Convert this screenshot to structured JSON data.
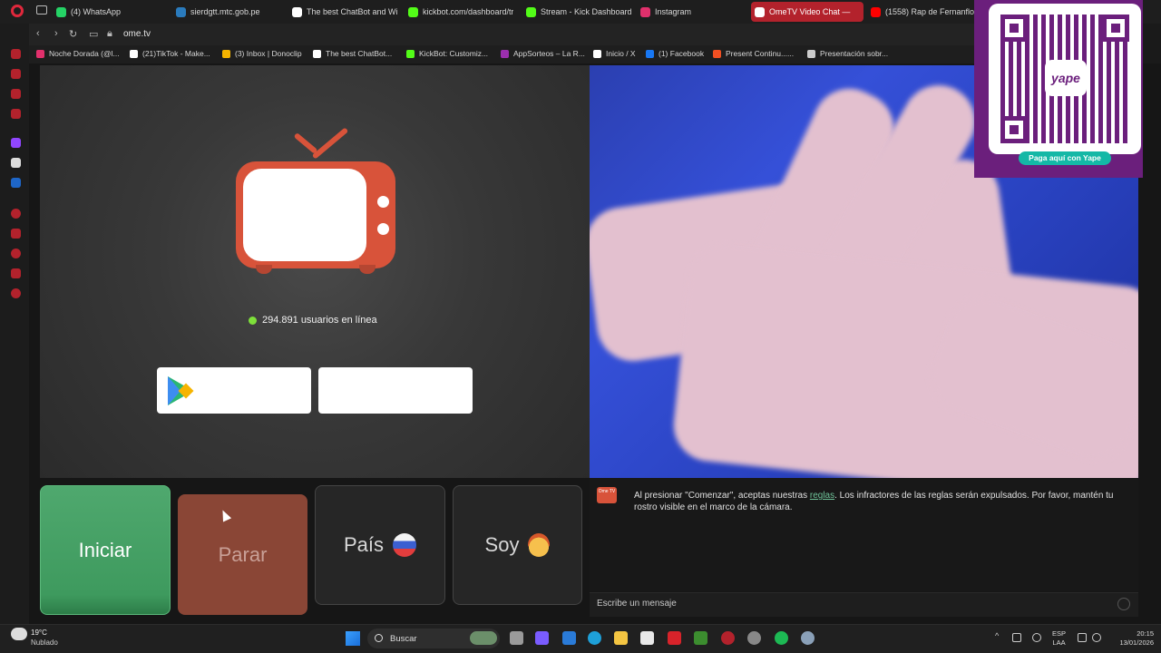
{
  "browser": {
    "tabs": [
      {
        "label": "(4) WhatsApp",
        "color": "#25d366"
      },
      {
        "label": "sierdgtt.mtc.gob.pe",
        "color": "#2a7bbd"
      },
      {
        "label": "The best ChatBot and Wid",
        "color": "#ffffff"
      },
      {
        "label": "kickbot.com/dashboard/tr",
        "color": "#53fc18"
      },
      {
        "label": "Stream - Kick Dashboard",
        "color": "#53fc18"
      },
      {
        "label": "Instagram",
        "color": "#e1306c"
      },
      {
        "label": "OmeTV Video Chat —",
        "color": "#ffffff"
      },
      {
        "label": "(1558) Rap de Fernanflo",
        "color": "#ff0000"
      }
    ],
    "url": "ome.tv",
    "bookmarks": [
      {
        "label": "Noche Dorada (@l...",
        "color": "#e1306c"
      },
      {
        "label": "(21)TikTok - Make...",
        "color": "#ffffff"
      },
      {
        "label": "(3) Inbox | Donoclip",
        "color": "#f5b400"
      },
      {
        "label": "The best ChatBot...",
        "color": "#ffffff"
      },
      {
        "label": "KickBot: Customiz...",
        "color": "#53fc18"
      },
      {
        "label": "AppSorteos – La R...",
        "color": "#9b2fae"
      },
      {
        "label": "Inicio / X",
        "color": "#ffffff"
      },
      {
        "label": "(1) Facebook",
        "color": "#1877f2"
      },
      {
        "label": "Present Continu......",
        "color": "#f25022"
      },
      {
        "label": "Presentación sobr...",
        "color": "#cccccc"
      }
    ]
  },
  "ometv": {
    "online_count": "294.891 usuarios en línea",
    "buttons": {
      "start": "Iniciar",
      "stop": "Parar",
      "country": "País",
      "soy": "Soy"
    },
    "chat": {
      "logo_text": "Ome TV",
      "message_before": "Al presionar \"Comenzar\", aceptas nuestras ",
      "rules_link": "reglas",
      "message_after": ". Los infractores de las reglas serán expulsados. Por favor, mantén tu rostro visible en el marco de la cámara.",
      "input_placeholder": "Escribe un mensaje"
    }
  },
  "qr_overlay": {
    "brand": "yape",
    "pay_label": "Paga aquí con Yape"
  },
  "taskbar": {
    "weather_temp": "19°C",
    "weather_cond": "Nublado",
    "search_label": "Buscar",
    "lang_1": "ESP",
    "lang_2": "LAA",
    "time": "20:15",
    "date": "13/01/2026"
  },
  "colors": {
    "accent_green": "#3e9a5e",
    "stop_red": "#8a4636",
    "ometv_orange": "#d8533a",
    "yape_purple": "#6b1f7c"
  }
}
